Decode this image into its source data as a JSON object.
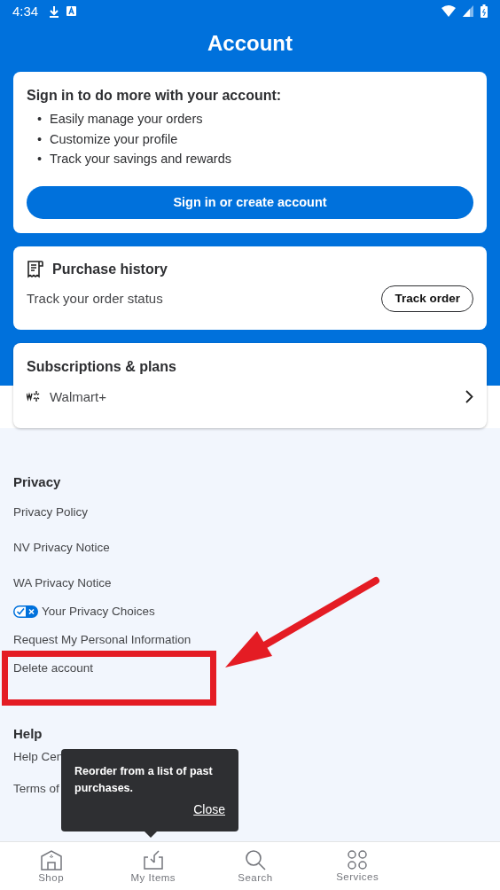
{
  "status_bar": {
    "time": "4:34"
  },
  "title": "Account",
  "sign_in_card": {
    "heading": "Sign in to do more with your account:",
    "bullet_mark": "•",
    "bullets": [
      "Easily manage your orders",
      "Customize your profile",
      "Track your savings and rewards"
    ],
    "button": "Sign in or create account"
  },
  "purchase_history": {
    "title": "Purchase history",
    "subtitle": "Track your order status",
    "button": "Track order"
  },
  "subscriptions": {
    "title": "Subscriptions & plans",
    "item": "Walmart+"
  },
  "privacy": {
    "heading": "Privacy",
    "links": [
      {
        "kind": "plain",
        "label": "Privacy Policy"
      },
      {
        "kind": "plain",
        "label": "NV Privacy Notice"
      },
      {
        "kind": "plain",
        "label": "WA Privacy Notice"
      },
      {
        "kind": "choices",
        "label": "Your Privacy Choices"
      },
      {
        "kind": "plain",
        "label": "Request My Personal Information"
      },
      {
        "kind": "plain",
        "label": "Delete account"
      }
    ]
  },
  "help": {
    "heading": "Help",
    "links": [
      "Help Cen",
      "Terms of"
    ]
  },
  "tooltip": {
    "text": "Reorder from a list of past purchases.",
    "close": "Close"
  },
  "bottom_nav": [
    {
      "kind": "shop",
      "label": "Shop",
      "selected": false
    },
    {
      "kind": "items",
      "label": "My Items",
      "selected": false
    },
    {
      "kind": "search",
      "label": "Search",
      "selected": false
    },
    {
      "kind": "services",
      "label": "Services",
      "selected": false
    }
  ]
}
